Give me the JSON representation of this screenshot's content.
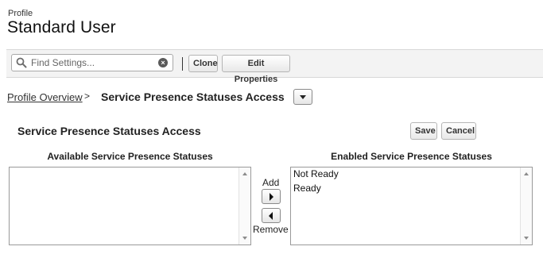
{
  "header": {
    "profile_label": "Profile",
    "title": "Standard User"
  },
  "toolbar": {
    "search_placeholder": "Find Settings...",
    "clone_label": "Clone",
    "edit_properties_label": "Edit Properties"
  },
  "breadcrumb": {
    "link": "Profile Overview",
    "separator": ">",
    "current": "Service Presence Statuses Access"
  },
  "section": {
    "title": "Service Presence Statuses Access",
    "save_label": "Save",
    "cancel_label": "Cancel"
  },
  "available": {
    "label": "Available Service Presence Statuses",
    "items": []
  },
  "enabled": {
    "label": "Enabled Service Presence Statuses",
    "items": [
      "Not Ready",
      "Ready"
    ]
  },
  "mover": {
    "add_label": "Add",
    "remove_label": "Remove"
  },
  "icons": {
    "search": "search-icon",
    "clear": "close-icon",
    "dropdown": "chevron-down-icon",
    "add": "arrow-right-icon",
    "remove": "arrow-left-icon"
  }
}
